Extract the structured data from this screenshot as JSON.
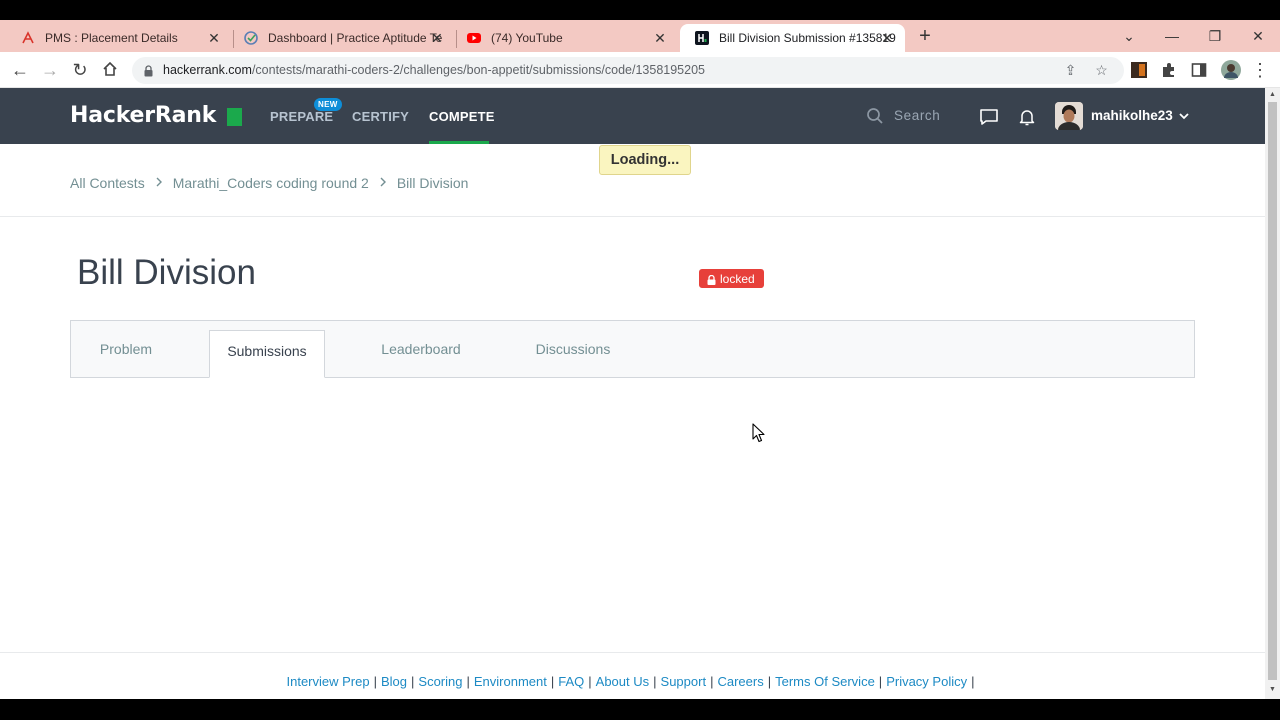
{
  "browser": {
    "tabs": [
      {
        "title": "PMS : Placement Details",
        "favicon": "pms-icon",
        "active": false
      },
      {
        "title": "Dashboard | Practice Aptitude Te",
        "favicon": "checkmark-circle-icon",
        "active": false
      },
      {
        "title": "(74) YouTube",
        "favicon": "youtube-icon",
        "active": false
      },
      {
        "title": "Bill Division Submission #135819",
        "favicon": "hackerrank-icon",
        "active": true
      }
    ],
    "url_host": "hackerrank.com",
    "url_path": "/contests/marathi-coders-2/challenges/bon-appetit/submissions/code/1358195205"
  },
  "nav": {
    "logo": "HackerRank",
    "links": [
      {
        "label": "PREPARE",
        "badge": "NEW"
      },
      {
        "label": "CERTIFY"
      },
      {
        "label": "COMPETE",
        "active": true
      }
    ],
    "search_placeholder": "Search",
    "username": "mahikolhe23"
  },
  "loading_text": "Loading...",
  "breadcrumb": [
    "All Contests",
    "Marathi_Coders coding round 2",
    "Bill Division"
  ],
  "page": {
    "title": "Bill Division",
    "status_badge": "locked"
  },
  "content_tabs": [
    {
      "label": "Problem",
      "active": false
    },
    {
      "label": "Submissions",
      "active": true
    },
    {
      "label": "Leaderboard",
      "active": false
    },
    {
      "label": "Discussions",
      "active": false
    }
  ],
  "footer_links": [
    "Interview Prep",
    "Blog",
    "Scoring",
    "Environment",
    "FAQ",
    "About Us",
    "Support",
    "Careers",
    "Terms Of Service",
    "Privacy Policy"
  ],
  "colors": {
    "nav_bg": "#39424e",
    "accent_green": "#1ba94c",
    "locked_red": "#e7403a",
    "link_blue": "#1d8ac4",
    "tabstrip": "#f3c9c3"
  }
}
